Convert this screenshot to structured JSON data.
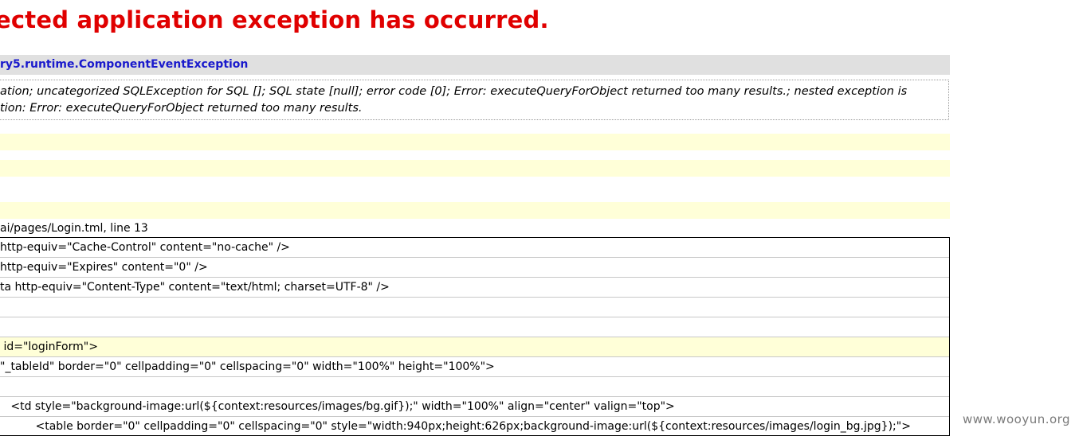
{
  "error": {
    "title": "ected application exception has occurred.",
    "exception_class": "ry5.runtime.ComponentEventException",
    "message_lines": [
      "ation; uncategorized SQLException for SQL []; SQL state [null]; error code [0]; Error: executeQueryForObject returned too many results.; nested exception is",
      "tion: Error: executeQueryForObject returned too many results."
    ],
    "location": "ai/pages/Login.tml, line 13"
  },
  "source_lines": [
    {
      "text": "http-equiv=\"Cache-Control\" content=\"no-cache\" />",
      "highlighted": false
    },
    {
      "text": "http-equiv=\"Expires\" content=\"0\" />",
      "highlighted": false
    },
    {
      "text": "ta http-equiv=\"Content-Type\" content=\"text/html; charset=UTF-8\" />",
      "highlighted": false
    },
    {
      "text": "",
      "highlighted": false
    },
    {
      "text": "",
      "highlighted": false
    },
    {
      "text": " id=\"loginForm\">",
      "highlighted": true
    },
    {
      "text": "\"_tableId\" border=\"0\" cellpadding=\"0\" cellspacing=\"0\" width=\"100%\" height=\"100%\">",
      "highlighted": false
    },
    {
      "text": "",
      "highlighted": false
    },
    {
      "text": "   <td style=\"background-image:url(${context:resources/images/bg.gif});\" width=\"100%\" align=\"center\" valign=\"top\">",
      "highlighted": false
    },
    {
      "text": "          <table border=\"0\" cellpadding=\"0\" cellspacing=\"0\" style=\"width:940px;height:626px;background-image:url(${context:resources/images/login_bg.jpg});\">",
      "highlighted": false
    }
  ],
  "watermark": "www.wooyun.org"
}
